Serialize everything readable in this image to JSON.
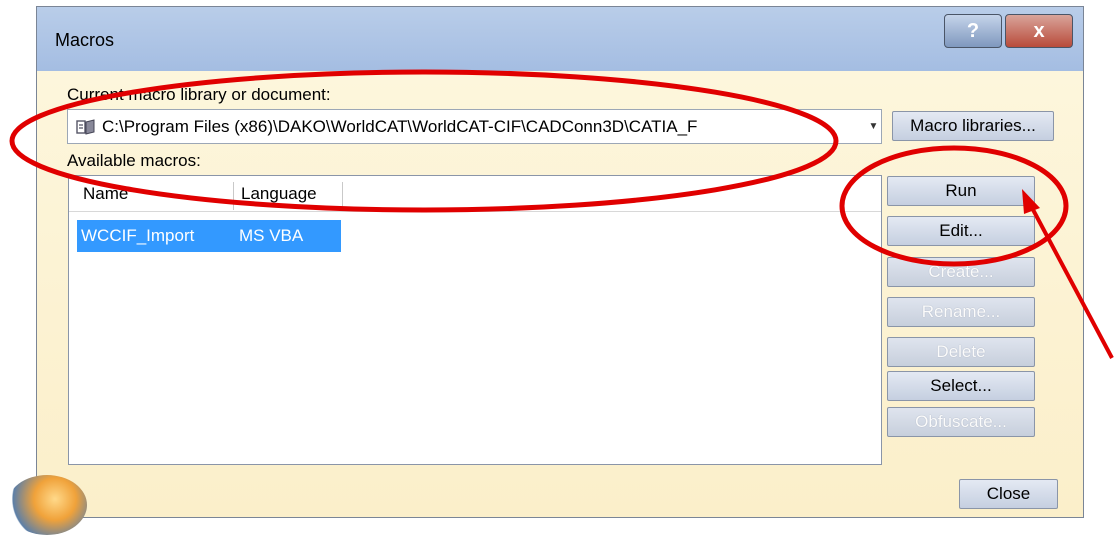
{
  "window": {
    "title": "Macros",
    "help_label": "?",
    "close_label": "x"
  },
  "library": {
    "label": "Current macro library or document:",
    "path": "C:\\Program Files (x86)\\DAKO\\WorldCAT\\WorldCAT-CIF\\CADConn3D\\CATIA_F",
    "libraries_button": "Macro libraries..."
  },
  "macros": {
    "label": "Available macros:",
    "columns": [
      "Name",
      "Language"
    ],
    "rows": [
      {
        "name": "WCCIF_Import",
        "language": "MS VBA",
        "selected": true
      }
    ]
  },
  "buttons": {
    "run": "Run",
    "edit": "Edit...",
    "create": "Create...",
    "rename": "Rename...",
    "delete": "Delete",
    "select": "Select...",
    "obfuscate": "Obfuscate...",
    "close": "Close"
  },
  "annotation_color": "#e00000",
  "selection_color": "#3399ff"
}
